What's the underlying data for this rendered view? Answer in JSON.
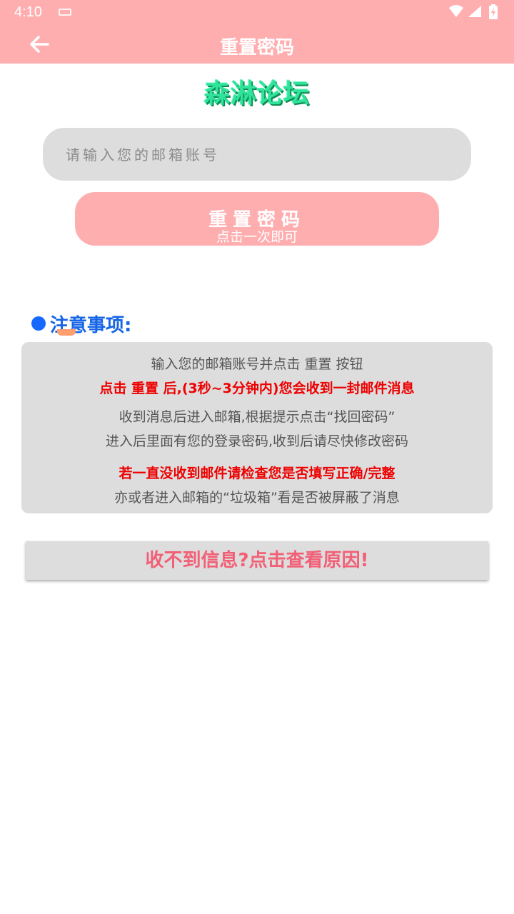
{
  "status_bar": {
    "time": "4:10",
    "icons": [
      "keyboard-icon",
      "wifi-icon",
      "signal-icon",
      "battery-icon"
    ]
  },
  "app_bar": {
    "title": "重置密码",
    "back_icon": "arrow-left-icon"
  },
  "logo": {
    "text": "森淋论坛",
    "color": "#2fe39a"
  },
  "email_input": {
    "placeholder": "请输入您的邮箱账号",
    "value": ""
  },
  "reset_button": {
    "label": "重置密码",
    "sublabel": "点击一次即可"
  },
  "notice": {
    "heading": "注意事项:",
    "lines": [
      "输入您的邮箱账号并点击 重置 按钮",
      "点击 重置 后,(3秒~3分钟内)您会收到一封邮件消息",
      "收到消息后进入邮箱,根据提示点击“找回密码”",
      "进入后里面有您的登录密码,收到后请尽快修改密码",
      "若一直没收到邮件请检查您是否填写正确/完整",
      "亦或者进入邮箱的“垃圾箱”看是否被屏蔽了消息"
    ]
  },
  "help_button": {
    "label": "收不到信息?点击查看原因!"
  },
  "colors": {
    "accent": "#ffaeb0",
    "notice_heading": "#1565e6",
    "warning": "#ee0000",
    "help_text": "#f25f76",
    "panel_bg": "#dddddd"
  }
}
